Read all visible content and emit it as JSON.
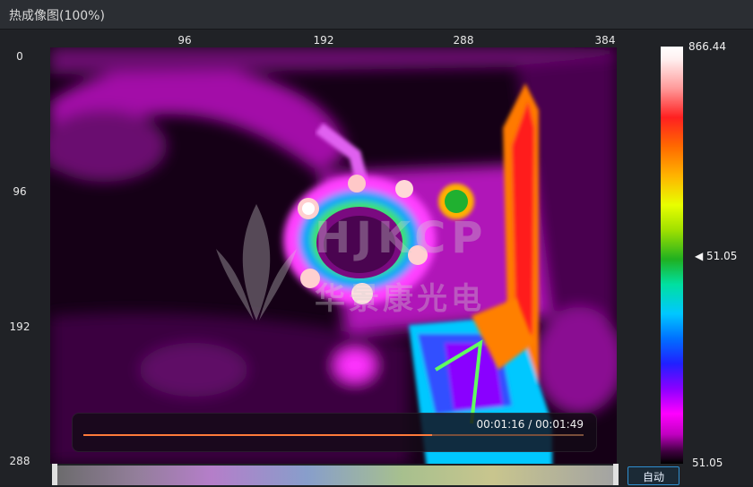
{
  "window": {
    "title": "热成像图(100%)"
  },
  "axes": {
    "x_ticks": [
      "96",
      "192",
      "288",
      "384"
    ],
    "y_ticks": [
      "0",
      "96",
      "192",
      "288"
    ]
  },
  "watermark": {
    "brand": "HJKCP",
    "cn_name": "华景康光电"
  },
  "player": {
    "time": "00:01:16 / 00:01:49",
    "progress_fraction": 0.697
  },
  "colorbar": {
    "max_label": "866.44",
    "min_label": "51.05",
    "pointer_label": "◀ 51.05",
    "colors": [
      "#ffffff",
      "#ff2020",
      "#ffb400",
      "#20b020",
      "#00c8ff",
      "#2020ff",
      "#ff00ff",
      "#000000"
    ]
  },
  "buttons": {
    "auto": "自动"
  }
}
